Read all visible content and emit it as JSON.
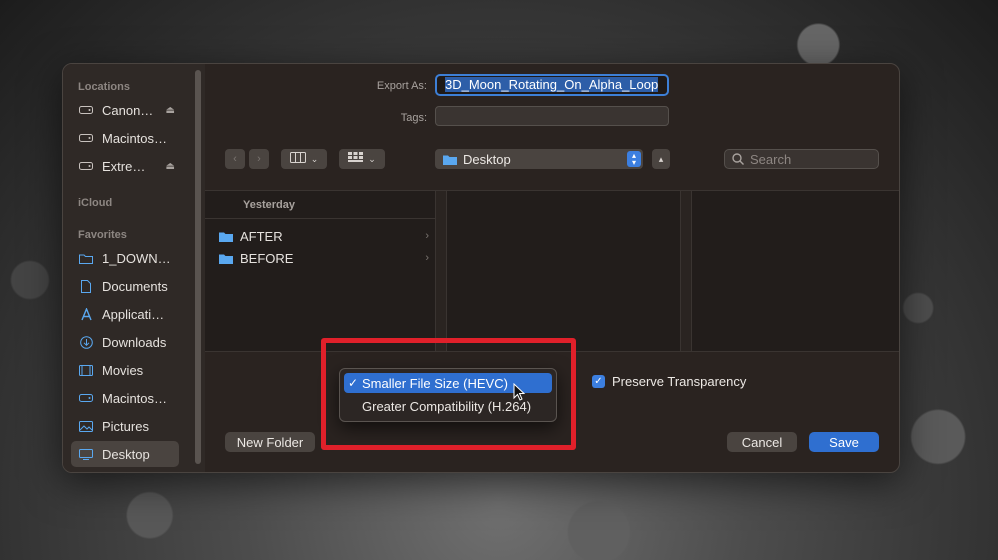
{
  "sidebar": {
    "sections": [
      {
        "label": "Locations"
      },
      {
        "label": "iCloud"
      },
      {
        "label": "Favorites"
      }
    ],
    "locations": [
      {
        "label": "Canon…",
        "icon": "drive-icon",
        "eject": "⏏"
      },
      {
        "label": "Macintos…",
        "icon": "drive-icon"
      },
      {
        "label": "Extre…",
        "icon": "drive-icon",
        "eject": "⏏"
      }
    ],
    "favorites": [
      {
        "label": "1_DOWN…",
        "icon": "folder-icon"
      },
      {
        "label": "Documents",
        "icon": "document-icon"
      },
      {
        "label": "Applicati…",
        "icon": "applications-icon"
      },
      {
        "label": "Downloads",
        "icon": "download-icon"
      },
      {
        "label": "Movies",
        "icon": "movies-icon"
      },
      {
        "label": "Macintos…",
        "icon": "drive-icon"
      },
      {
        "label": "Pictures",
        "icon": "pictures-icon"
      },
      {
        "label": "Desktop",
        "icon": "desktop-icon",
        "selected": true
      }
    ]
  },
  "export": {
    "label": "Export As:",
    "value": "3D_Moon_Rotating_On_Alpha_Loop"
  },
  "tags": {
    "label": "Tags:",
    "value": ""
  },
  "toolbar": {
    "location": "Desktop",
    "search_placeholder": "Search"
  },
  "browser": {
    "group_header": "Yesterday",
    "items": [
      {
        "label": "AFTER"
      },
      {
        "label": "BEFORE"
      }
    ]
  },
  "options": {
    "format_menu": [
      {
        "label": "Smaller File Size (HEVC)",
        "checked": true
      },
      {
        "label": "Greater Compatibility (H.264)",
        "checked": false
      }
    ],
    "preserve_transparency": {
      "label": "Preserve Transparency",
      "checked": true
    }
  },
  "buttons": {
    "new_folder": "New Folder",
    "cancel": "Cancel",
    "save": "Save"
  },
  "colors": {
    "accent": "#3c7fe0",
    "highlight_box": "#e0202a"
  }
}
